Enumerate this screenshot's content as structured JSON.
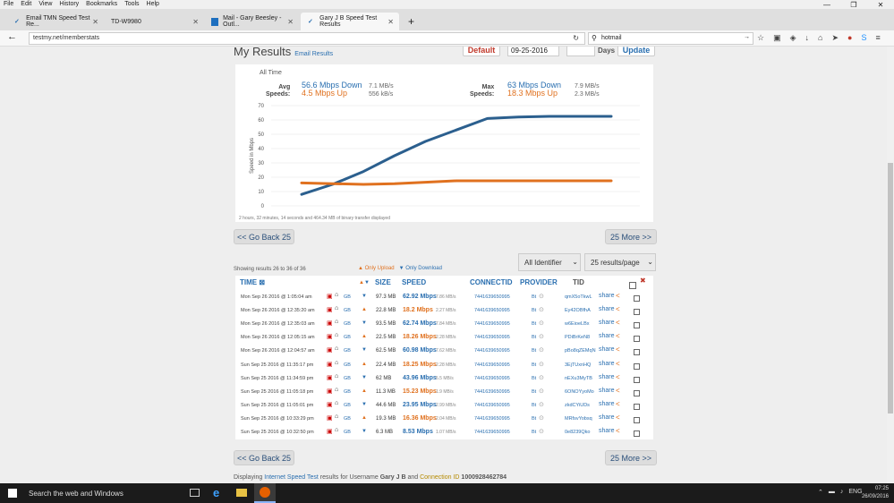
{
  "menu": [
    "File",
    "Edit",
    "View",
    "History",
    "Bookmarks",
    "Tools",
    "Help"
  ],
  "window_controls": [
    "—",
    "❐",
    "✕"
  ],
  "tabs": [
    {
      "label": "Email TMN Speed Test Re...",
      "icon_color": "#2a6fb0"
    },
    {
      "label": "TD-W9980",
      "icon_color": "#777"
    },
    {
      "label": "Mail - Gary Beesley - Outl...",
      "icon_color": "#1e6fbf"
    },
    {
      "label": "Gary J B Speed Test Results",
      "icon_color": "#2a6fb0"
    }
  ],
  "url": "testmy.net/memberstats",
  "search_value": "hotmail",
  "header": {
    "title": "My Results",
    "email_link": "Email Results",
    "default_btn": "Default",
    "date": "09-25-2016",
    "days_label": "Days",
    "update_btn": "Update"
  },
  "stats": {
    "period": "All Time",
    "avg_label_1": "Avg",
    "avg_label_2": "Speeds:",
    "avg_down": "56.6 Mbps Down",
    "avg_up": "4.5 Mbps Up",
    "avg_down_kb": "7.1 MB/s",
    "avg_up_kb": "556 kB/s",
    "max_label_1": "Max",
    "max_label_2": "Speeds:",
    "max_down": "63 Mbps Down",
    "max_up": "18.3 Mbps Up",
    "max_down_kb": "7.9 MB/s",
    "max_up_kb": "2.3 MB/s",
    "footnote": "2 hours, 32 minutes, 14 seconds and 464.34 MB of binary transfer displayed"
  },
  "chart_data": {
    "type": "line",
    "ylabel": "Speed in Mbps",
    "ylim": [
      0,
      70
    ],
    "yticks": [
      0,
      10,
      20,
      30,
      40,
      50,
      60,
      70
    ],
    "x": [
      1,
      2,
      3,
      4,
      5,
      6,
      7,
      8,
      9,
      10,
      11
    ],
    "series": [
      {
        "color": "#2b5f8e",
        "values": [
          8,
          15,
          24,
          35,
          45,
          53,
          61,
          62,
          62.5,
          62.5,
          62.5
        ]
      },
      {
        "color": "#e0711f",
        "values": [
          16,
          15.5,
          15,
          15.5,
          16.5,
          17.5,
          17.5,
          17.5,
          17.5,
          17.5,
          17.5
        ]
      }
    ],
    "grid": true
  },
  "nav": {
    "back": "<< Go Back 25",
    "more": "25 More >>"
  },
  "filters": {
    "identifier": "All Identifier",
    "per_page": "25 results/page"
  },
  "showing": "Showing results 26 to 36 of 36",
  "legend": {
    "upload": "Only Upload",
    "download": "Only Download"
  },
  "columns": [
    "TIME",
    "SIZE",
    "SPEED",
    "CONNECTID",
    "PROVIDER",
    "TID"
  ],
  "rows": [
    {
      "time": "Mon Sep 26 2016 @ 1:05:04 am",
      "dir": "down",
      "size": "97.3 MB",
      "speed": "62.92 Mbps",
      "rate": "7.86 MB/s",
      "cid": "7441639650995",
      "prov": "Bt",
      "tid": "qmX5oTkwL"
    },
    {
      "time": "Mon Sep 26 2016 @ 12:35:20 am",
      "dir": "up",
      "size": "22.8 MB",
      "speed": "18.2 Mbps",
      "rate": "2.27 MB/s",
      "cid": "7441639650995",
      "prov": "Bt",
      "tid": "Ey42OBfhA"
    },
    {
      "time": "Mon Sep 26 2016 @ 12:35:03 am",
      "dir": "down",
      "size": "93.5 MB",
      "speed": "62.74 Mbps",
      "rate": "7.84 MB/s",
      "cid": "7441639650995",
      "prov": "Bt",
      "tid": "w6EioeLBx"
    },
    {
      "time": "Mon Sep 26 2016 @ 12:05:15 am",
      "dir": "up",
      "size": "22.5 MB",
      "speed": "18.26 Mbps",
      "rate": "2.28 MB/s",
      "cid": "7441639650995",
      "prov": "Bt",
      "tid": "PDiBrKeN8"
    },
    {
      "time": "Mon Sep 26 2016 @ 12:04:57 am",
      "dir": "down",
      "size": "62.5 MB",
      "speed": "60.98 Mbps",
      "rate": "7.62 MB/s",
      "cid": "7441639650995",
      "prov": "Bt",
      "tid": "pBo8qZEMqN"
    },
    {
      "time": "Sun Sep 25 2016 @ 11:35:17 pm",
      "dir": "up",
      "size": "22.4 MB",
      "speed": "18.25 Mbps",
      "rate": "2.28 MB/s",
      "cid": "7441639650995",
      "prov": "Bt",
      "tid": "3EjTUxnHQ"
    },
    {
      "time": "Sun Sep 25 2016 @ 11:34:59 pm",
      "dir": "down",
      "size": "62 MB",
      "speed": "43.96 Mbps",
      "rate": "5.5 MB/s",
      "cid": "7441639650995",
      "prov": "Bt",
      "tid": "nEXu3MyTB"
    },
    {
      "time": "Sun Sep 25 2016 @ 11:05:18 pm",
      "dir": "up",
      "size": "11.3 MB",
      "speed": "15.23 Mbps",
      "rate": "1.9 MB/s",
      "cid": "7441639650995",
      "prov": "Bt",
      "tid": "6ONOYyoMo"
    },
    {
      "time": "Sun Sep 25 2016 @ 11:05:01 pm",
      "dir": "down",
      "size": "44.6 MB",
      "speed": "23.95 Mbps",
      "rate": "2.99 MB/s",
      "cid": "7441639650995",
      "prov": "Bt",
      "tid": "zkdCYiUDs"
    },
    {
      "time": "Sun Sep 25 2016 @ 10:33:29 pm",
      "dir": "up",
      "size": "19.3 MB",
      "speed": "16.36 Mbps",
      "rate": "2.04 MB/s",
      "cid": "7441639650995",
      "prov": "Bt",
      "tid": "MRfsvYobsq"
    },
    {
      "time": "Sun Sep 25 2016 @ 10:32:50 pm",
      "dir": "down",
      "size": "6.3 MB",
      "speed": "8.53 Mbps",
      "rate": "1.07 MB/s",
      "cid": "7441639650995",
      "prov": "Bt",
      "tid": "0e8239Qko"
    }
  ],
  "country": "GB",
  "share_label": "share",
  "footer": {
    "prefix": "Displaying",
    "link": "Internet Speed Test",
    "mid": "results for Username",
    "user": "Gary J B",
    "and": "and",
    "cid_label": "Connection ID",
    "cid": "1000928462784"
  },
  "taskbar": {
    "search": "Search the web and Windows",
    "lang": "ENG",
    "time": "07:25",
    "date": "26/09/2016"
  },
  "colors": {
    "down": "#2a6fb0",
    "up": "#e0711f"
  }
}
